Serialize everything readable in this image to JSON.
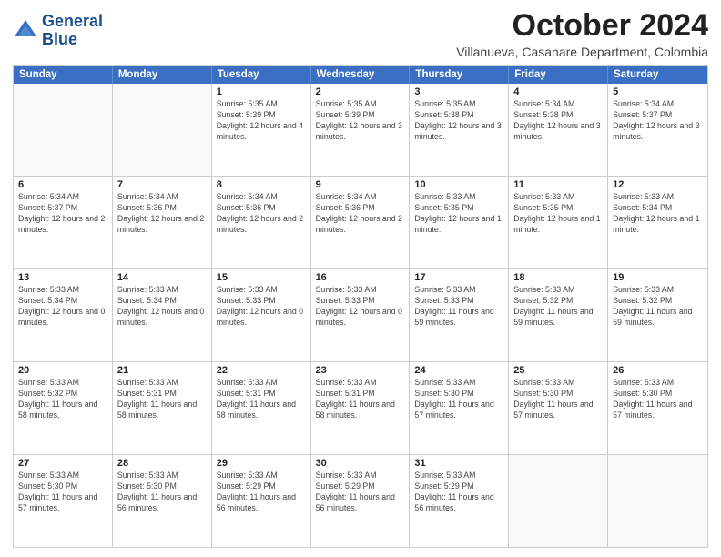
{
  "header": {
    "logo_line1": "General",
    "logo_line2": "Blue",
    "month_title": "October 2024",
    "location": "Villanueva, Casanare Department, Colombia"
  },
  "days_of_week": [
    "Sunday",
    "Monday",
    "Tuesday",
    "Wednesday",
    "Thursday",
    "Friday",
    "Saturday"
  ],
  "weeks": [
    [
      {
        "day": "",
        "info": ""
      },
      {
        "day": "",
        "info": ""
      },
      {
        "day": "1",
        "info": "Sunrise: 5:35 AM\nSunset: 5:39 PM\nDaylight: 12 hours and 4 minutes."
      },
      {
        "day": "2",
        "info": "Sunrise: 5:35 AM\nSunset: 5:39 PM\nDaylight: 12 hours and 3 minutes."
      },
      {
        "day": "3",
        "info": "Sunrise: 5:35 AM\nSunset: 5:38 PM\nDaylight: 12 hours and 3 minutes."
      },
      {
        "day": "4",
        "info": "Sunrise: 5:34 AM\nSunset: 5:38 PM\nDaylight: 12 hours and 3 minutes."
      },
      {
        "day": "5",
        "info": "Sunrise: 5:34 AM\nSunset: 5:37 PM\nDaylight: 12 hours and 3 minutes."
      }
    ],
    [
      {
        "day": "6",
        "info": "Sunrise: 5:34 AM\nSunset: 5:37 PM\nDaylight: 12 hours and 2 minutes."
      },
      {
        "day": "7",
        "info": "Sunrise: 5:34 AM\nSunset: 5:36 PM\nDaylight: 12 hours and 2 minutes."
      },
      {
        "day": "8",
        "info": "Sunrise: 5:34 AM\nSunset: 5:36 PM\nDaylight: 12 hours and 2 minutes."
      },
      {
        "day": "9",
        "info": "Sunrise: 5:34 AM\nSunset: 5:36 PM\nDaylight: 12 hours and 2 minutes."
      },
      {
        "day": "10",
        "info": "Sunrise: 5:33 AM\nSunset: 5:35 PM\nDaylight: 12 hours and 1 minute."
      },
      {
        "day": "11",
        "info": "Sunrise: 5:33 AM\nSunset: 5:35 PM\nDaylight: 12 hours and 1 minute."
      },
      {
        "day": "12",
        "info": "Sunrise: 5:33 AM\nSunset: 5:34 PM\nDaylight: 12 hours and 1 minute."
      }
    ],
    [
      {
        "day": "13",
        "info": "Sunrise: 5:33 AM\nSunset: 5:34 PM\nDaylight: 12 hours and 0 minutes."
      },
      {
        "day": "14",
        "info": "Sunrise: 5:33 AM\nSunset: 5:34 PM\nDaylight: 12 hours and 0 minutes."
      },
      {
        "day": "15",
        "info": "Sunrise: 5:33 AM\nSunset: 5:33 PM\nDaylight: 12 hours and 0 minutes."
      },
      {
        "day": "16",
        "info": "Sunrise: 5:33 AM\nSunset: 5:33 PM\nDaylight: 12 hours and 0 minutes."
      },
      {
        "day": "17",
        "info": "Sunrise: 5:33 AM\nSunset: 5:33 PM\nDaylight: 11 hours and 59 minutes."
      },
      {
        "day": "18",
        "info": "Sunrise: 5:33 AM\nSunset: 5:32 PM\nDaylight: 11 hours and 59 minutes."
      },
      {
        "day": "19",
        "info": "Sunrise: 5:33 AM\nSunset: 5:32 PM\nDaylight: 11 hours and 59 minutes."
      }
    ],
    [
      {
        "day": "20",
        "info": "Sunrise: 5:33 AM\nSunset: 5:32 PM\nDaylight: 11 hours and 58 minutes."
      },
      {
        "day": "21",
        "info": "Sunrise: 5:33 AM\nSunset: 5:31 PM\nDaylight: 11 hours and 58 minutes."
      },
      {
        "day": "22",
        "info": "Sunrise: 5:33 AM\nSunset: 5:31 PM\nDaylight: 11 hours and 58 minutes."
      },
      {
        "day": "23",
        "info": "Sunrise: 5:33 AM\nSunset: 5:31 PM\nDaylight: 11 hours and 58 minutes."
      },
      {
        "day": "24",
        "info": "Sunrise: 5:33 AM\nSunset: 5:30 PM\nDaylight: 11 hours and 57 minutes."
      },
      {
        "day": "25",
        "info": "Sunrise: 5:33 AM\nSunset: 5:30 PM\nDaylight: 11 hours and 57 minutes."
      },
      {
        "day": "26",
        "info": "Sunrise: 5:33 AM\nSunset: 5:30 PM\nDaylight: 11 hours and 57 minutes."
      }
    ],
    [
      {
        "day": "27",
        "info": "Sunrise: 5:33 AM\nSunset: 5:30 PM\nDaylight: 11 hours and 57 minutes."
      },
      {
        "day": "28",
        "info": "Sunrise: 5:33 AM\nSunset: 5:30 PM\nDaylight: 11 hours and 56 minutes."
      },
      {
        "day": "29",
        "info": "Sunrise: 5:33 AM\nSunset: 5:29 PM\nDaylight: 11 hours and 56 minutes."
      },
      {
        "day": "30",
        "info": "Sunrise: 5:33 AM\nSunset: 5:29 PM\nDaylight: 11 hours and 56 minutes."
      },
      {
        "day": "31",
        "info": "Sunrise: 5:33 AM\nSunset: 5:29 PM\nDaylight: 11 hours and 56 minutes."
      },
      {
        "day": "",
        "info": ""
      },
      {
        "day": "",
        "info": ""
      }
    ]
  ]
}
